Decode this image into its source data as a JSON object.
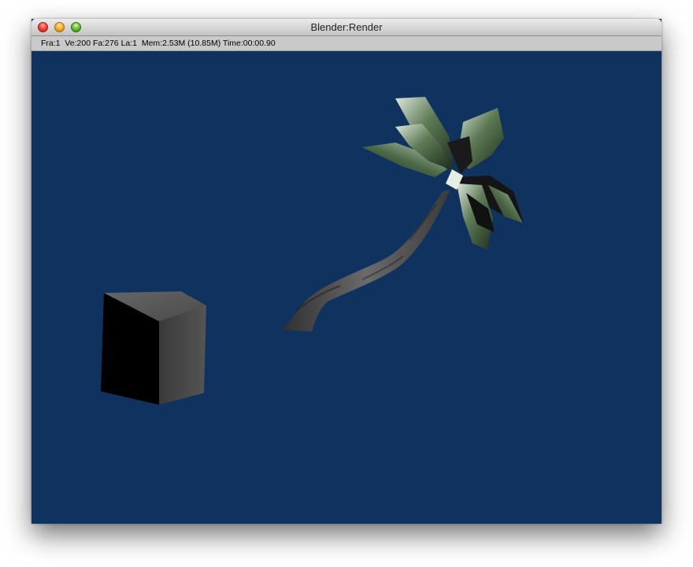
{
  "window": {
    "title": "Blender:Render"
  },
  "status": {
    "text": "Fra:1  Ve:200 Fa:276 La:1  Mem:2.53M (10.85M) Time:00:00.90"
  },
  "scene": {
    "background_color": "#10325f",
    "objects": [
      "cube",
      "palm-tree"
    ]
  }
}
